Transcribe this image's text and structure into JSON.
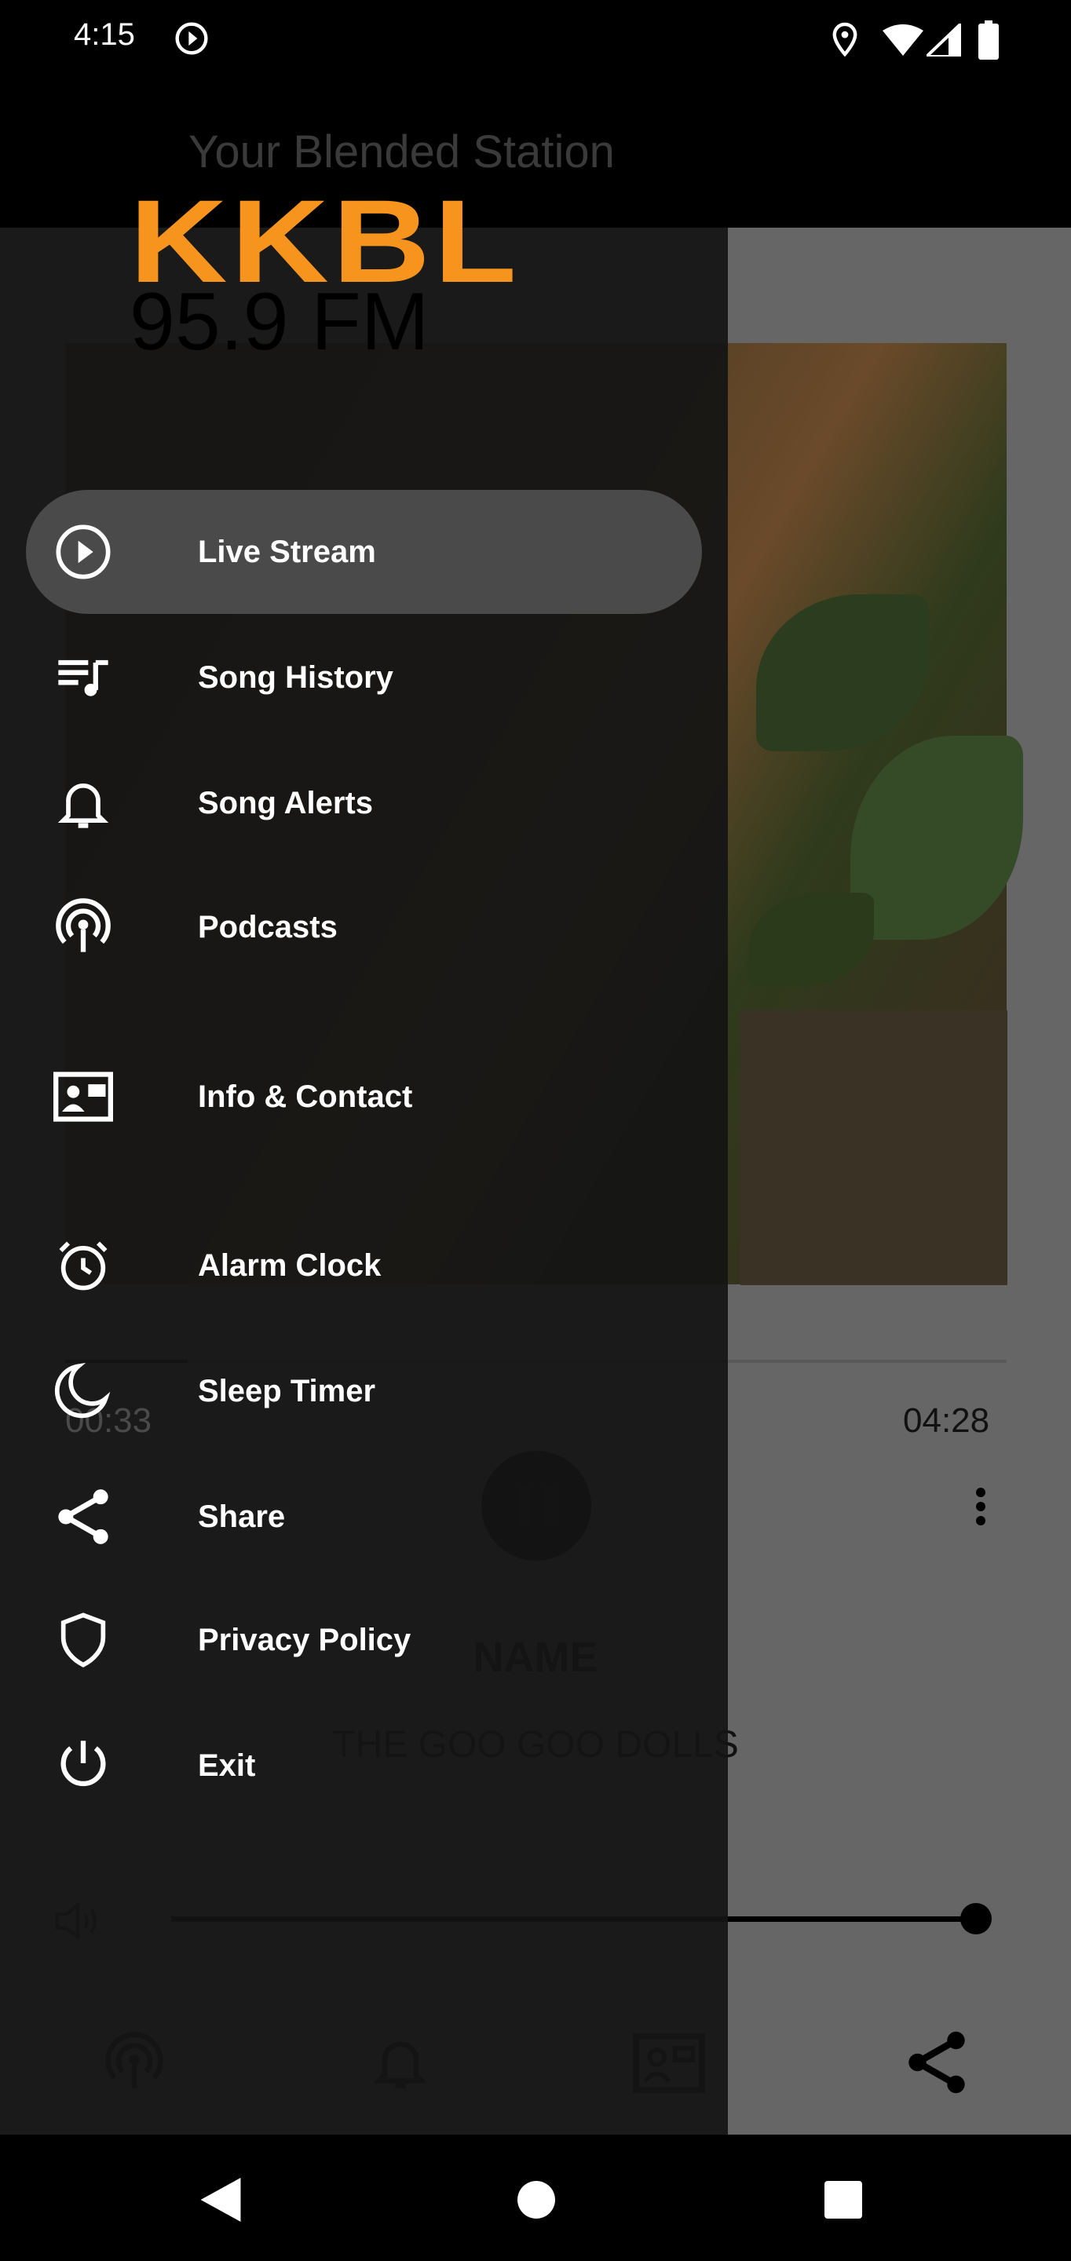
{
  "status_bar": {
    "time": "4:15",
    "icons": [
      "media-play-icon",
      "location-icon",
      "wifi-icon",
      "signal-icon",
      "battery-icon"
    ]
  },
  "app_bar": {
    "title": "Your Blended Station",
    "menu_icon": "hamburger-icon"
  },
  "logo": {
    "name": "KKBL",
    "frequency": "95.9 FM",
    "brand_color": "#F7941D"
  },
  "player": {
    "elapsed": "00:33",
    "duration": "04:28",
    "song": "NAME",
    "artist": "THE GOO GOO DOLLS",
    "progress": 0.13,
    "volume": 1.0
  },
  "bottom_nav": [
    "podcast-icon",
    "bell-icon",
    "contact-card-icon",
    "share-icon"
  ],
  "drawer": {
    "items": [
      {
        "label": "Live Stream",
        "icon": "play-circle-icon",
        "active": true
      },
      {
        "label": "Song History",
        "icon": "playlist-icon"
      },
      {
        "label": "Song Alerts",
        "icon": "bell-icon"
      },
      {
        "label": "Podcasts",
        "icon": "podcast-icon"
      },
      {
        "label": "Info & Contact",
        "icon": "contact-card-icon"
      },
      {
        "label": "Alarm Clock",
        "icon": "alarm-clock-icon"
      },
      {
        "label": "Sleep Timer",
        "icon": "moon-icon"
      },
      {
        "label": "Share",
        "icon": "share-icon"
      },
      {
        "label": "Privacy Policy",
        "icon": "shield-icon"
      },
      {
        "label": "Exit",
        "icon": "power-icon"
      }
    ]
  }
}
